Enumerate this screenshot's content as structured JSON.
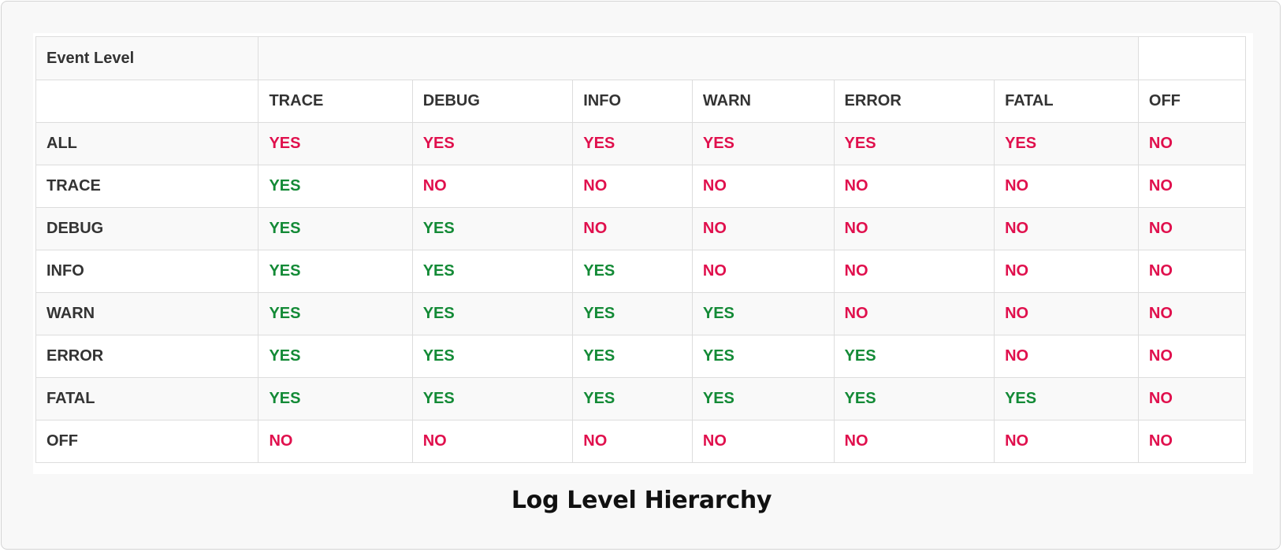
{
  "table": {
    "corner_label": "Event Level",
    "columns": [
      "TRACE",
      "DEBUG",
      "INFO",
      "WARN",
      "ERROR",
      "FATAL",
      "OFF"
    ],
    "rows": [
      {
        "label": "ALL",
        "values": [
          "YES",
          "YES",
          "YES",
          "YES",
          "YES",
          "YES",
          "NO"
        ],
        "style": [
          "no",
          "no",
          "no",
          "no",
          "no",
          "no",
          "no"
        ]
      },
      {
        "label": "TRACE",
        "values": [
          "YES",
          "NO",
          "NO",
          "NO",
          "NO",
          "NO",
          "NO"
        ],
        "style": [
          "yes",
          "no",
          "no",
          "no",
          "no",
          "no",
          "no"
        ]
      },
      {
        "label": "DEBUG",
        "values": [
          "YES",
          "YES",
          "NO",
          "NO",
          "NO",
          "NO",
          "NO"
        ],
        "style": [
          "yes",
          "yes",
          "no",
          "no",
          "no",
          "no",
          "no"
        ]
      },
      {
        "label": "INFO",
        "values": [
          "YES",
          "YES",
          "YES",
          "NO",
          "NO",
          "NO",
          "NO"
        ],
        "style": [
          "yes",
          "yes",
          "yes",
          "no",
          "no",
          "no",
          "no"
        ]
      },
      {
        "label": "WARN",
        "values": [
          "YES",
          "YES",
          "YES",
          "YES",
          "NO",
          "NO",
          "NO"
        ],
        "style": [
          "yes",
          "yes",
          "yes",
          "yes",
          "no",
          "no",
          "no"
        ]
      },
      {
        "label": "ERROR",
        "values": [
          "YES",
          "YES",
          "YES",
          "YES",
          "YES",
          "NO",
          "NO"
        ],
        "style": [
          "yes",
          "yes",
          "yes",
          "yes",
          "yes",
          "no",
          "no"
        ]
      },
      {
        "label": "FATAL",
        "values": [
          "YES",
          "YES",
          "YES",
          "YES",
          "YES",
          "YES",
          "NO"
        ],
        "style": [
          "yes",
          "yes",
          "yes",
          "yes",
          "yes",
          "yes",
          "no"
        ]
      },
      {
        "label": "OFF",
        "values": [
          "NO",
          "NO",
          "NO",
          "NO",
          "NO",
          "NO",
          "NO"
        ],
        "style": [
          "no",
          "no",
          "no",
          "no",
          "no",
          "no",
          "no"
        ]
      }
    ]
  },
  "caption": "Log Level Hierarchy",
  "colors": {
    "yes": "#138a36",
    "no": "#e0104d",
    "text": "#333333"
  }
}
